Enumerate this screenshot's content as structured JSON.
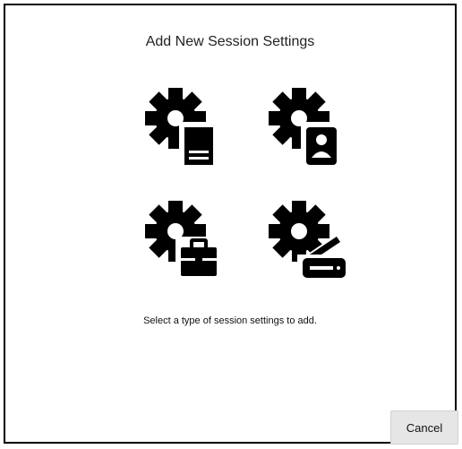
{
  "dialog": {
    "title": "Add New Session Settings",
    "hint": "Select a type of session settings to add.",
    "cancel_label": "Cancel"
  },
  "options": [
    {
      "icon": "gear-document-icon"
    },
    {
      "icon": "gear-person-badge-icon"
    },
    {
      "icon": "gear-briefcase-icon"
    },
    {
      "icon": "gear-scanner-icon"
    }
  ],
  "colors": {
    "icon": "#000000",
    "background": "#ffffff",
    "button_bg": "#e6e6e6"
  }
}
